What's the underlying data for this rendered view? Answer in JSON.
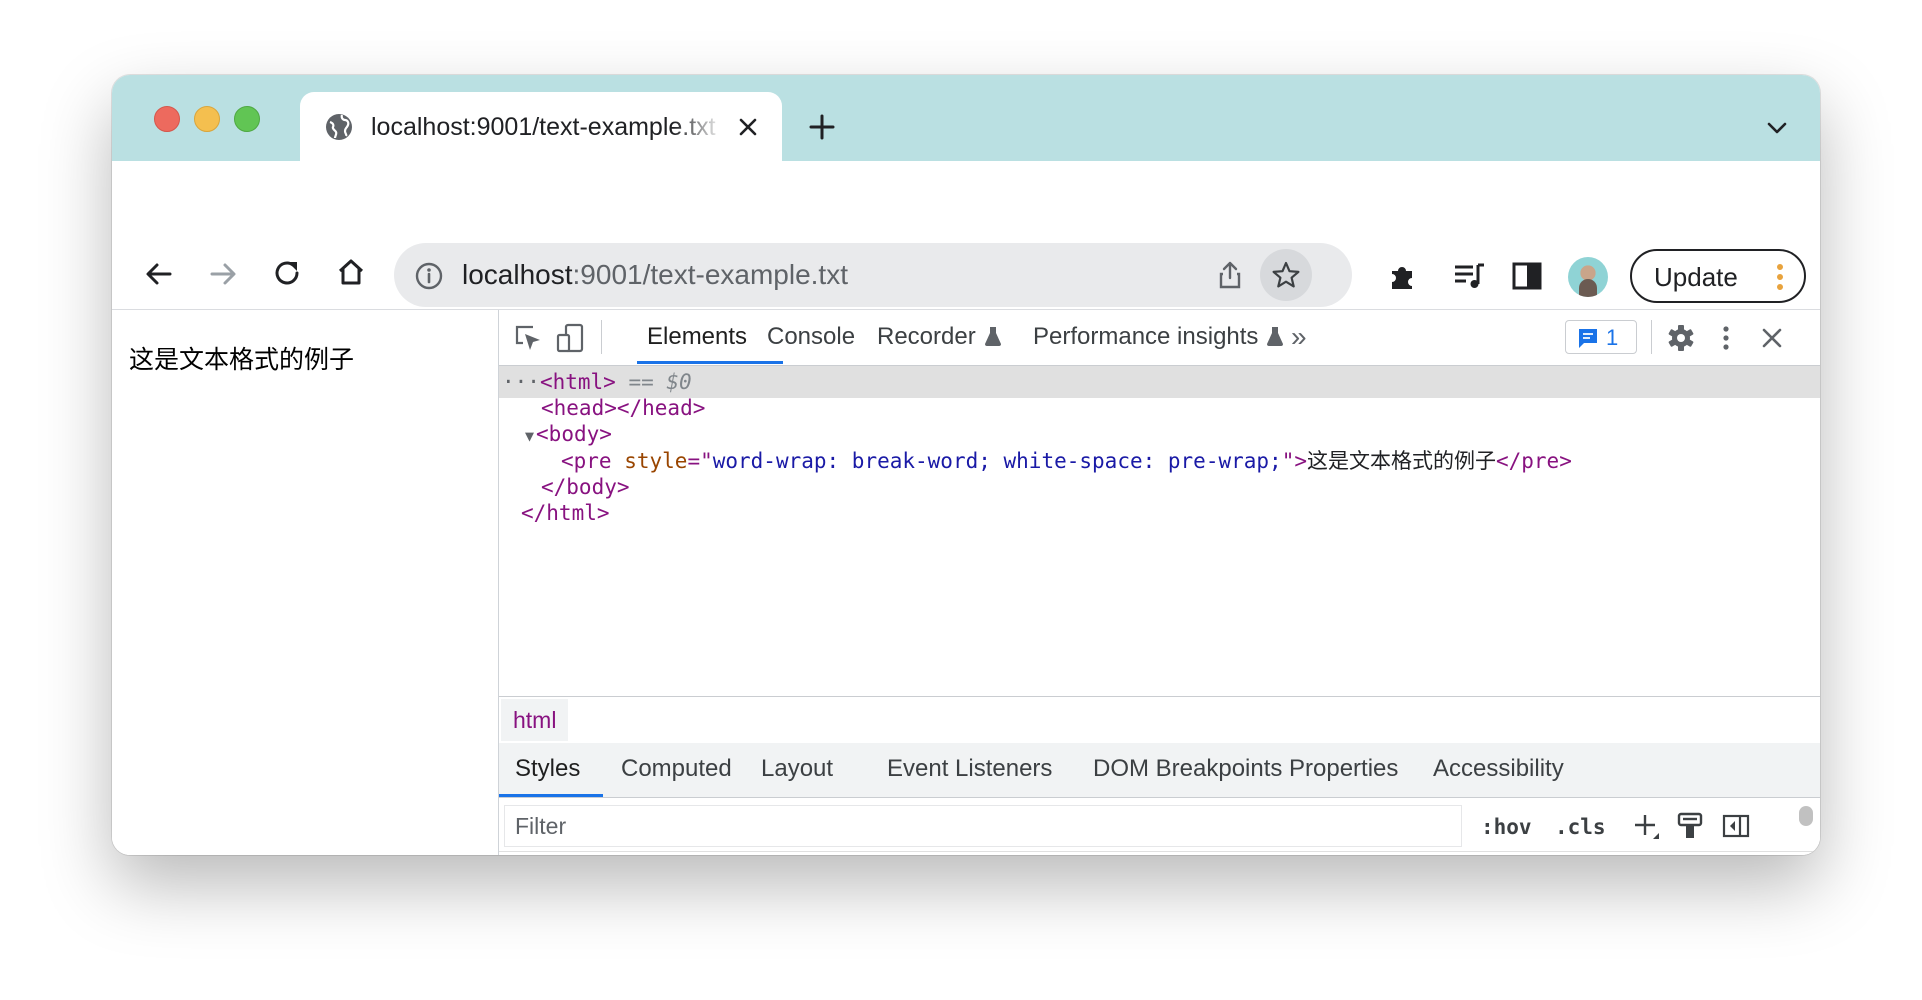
{
  "tab": {
    "title": "localhost:9001/text-example.txt"
  },
  "omnibox": {
    "host": "localhost",
    "path": ":9001/text-example.txt"
  },
  "toolbar": {
    "update_label": "Update"
  },
  "page": {
    "text": "这是文本格式的例子"
  },
  "devtools": {
    "tabs": [
      {
        "label": "Elements"
      },
      {
        "label": "Console"
      },
      {
        "label": "Recorder"
      },
      {
        "label": "Performance insights"
      }
    ],
    "more_tabs": "»",
    "issues_count": "1",
    "tree": {
      "ellipsis": "···",
      "html_open": "<html>",
      "selected_marker": " == $0",
      "head": "<head></head>",
      "caret": "▼",
      "body_open": "<body>",
      "pre_open_start": "<pre",
      "pre_attr_name": " style",
      "pre_attr_eq": "=\"",
      "pre_attr_value": "word-wrap: break-word; white-space: pre-wrap;",
      "pre_attr_close": "\">",
      "pre_text": "这是文本格式的例子",
      "pre_close": "</pre>",
      "body_close": "</body>",
      "html_close": "</html>"
    },
    "breadcrumb": "html",
    "sidebar_tabs": [
      {
        "label": "Styles"
      },
      {
        "label": "Computed"
      },
      {
        "label": "Layout"
      },
      {
        "label": "Event Listeners"
      },
      {
        "label": "DOM Breakpoints"
      },
      {
        "label": "Properties"
      },
      {
        "label": "Accessibility"
      }
    ],
    "filter": {
      "placeholder": "Filter",
      "hov": ":hov",
      "cls": ".cls"
    }
  },
  "colors": {
    "tab_strip": "#bae0e2",
    "accent": "#1a73e8",
    "tag": "#881280",
    "attr_name": "#994500",
    "attr_value": "#1a1aa6"
  },
  "icons": [
    "globe-icon",
    "close-icon",
    "plus-icon",
    "chevron-down-icon",
    "back-arrow-icon",
    "forward-arrow-icon",
    "reload-icon",
    "home-icon",
    "info-icon",
    "share-icon",
    "star-icon",
    "puzzle-icon",
    "media-control-icon",
    "side-panel-icon",
    "avatar",
    "kebab-menu-icon",
    "inspect-icon",
    "device-toggle-icon",
    "flask-icon",
    "chat-icon",
    "gear-icon",
    "new-style-rule-icon",
    "paint-icon",
    "sidebar-toggle-icon"
  ]
}
